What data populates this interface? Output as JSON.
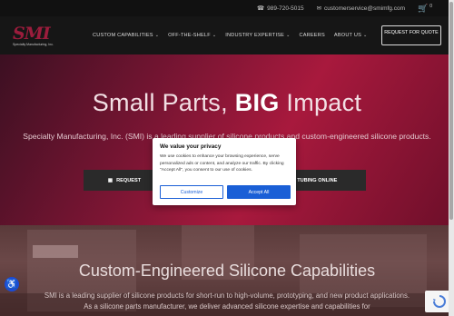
{
  "topbar": {
    "phone": "989-720-5015",
    "email": "customerservice@smimfg.com",
    "cart_count": "0"
  },
  "nav": {
    "logo_text": "SMI",
    "logo_sub": "Specialty Manufacturing, Inc.",
    "items": [
      {
        "label": "CUSTOM CAPABILITIES",
        "dropdown": true
      },
      {
        "label": "OFF-THE-SHELF",
        "dropdown": true
      },
      {
        "label": "INDUSTRY EXPERTISE",
        "dropdown": true
      },
      {
        "label": "CAREERS",
        "dropdown": false
      },
      {
        "label": "ABOUT US",
        "dropdown": true
      }
    ],
    "quote_button": "REQUEST FOR QUOTE"
  },
  "hero": {
    "title_light": "Small Parts, ",
    "title_bold": "BIG",
    "title_end": " Impact",
    "subtitle": "Specialty Manufacturing, Inc. (SMI) is a leading supplier of silicone products and custom-engineered silicone products.",
    "btn1": "REQUEST",
    "btn2": "& TUBING ONLINE"
  },
  "section2": {
    "title": "Custom-Engineered Silicone Capabilities",
    "text": "SMI is a leading supplier of silicone products for short-run to high-volume, prototyping, and new product applications. As a silicone parts manufacturer, we deliver advanced silicone expertise and capabilities for"
  },
  "cookie": {
    "title": "We value your privacy",
    "body": "We use cookies to enhance your browsing experience, serve personalized ads or content, and analyze our traffic. By clicking \"Accept All\", you consent to our use of cookies.",
    "customize": "Customize",
    "accept": "Accept All"
  },
  "colors": {
    "brand": "#9b1c3c",
    "accept_blue": "#1a5fd6"
  }
}
